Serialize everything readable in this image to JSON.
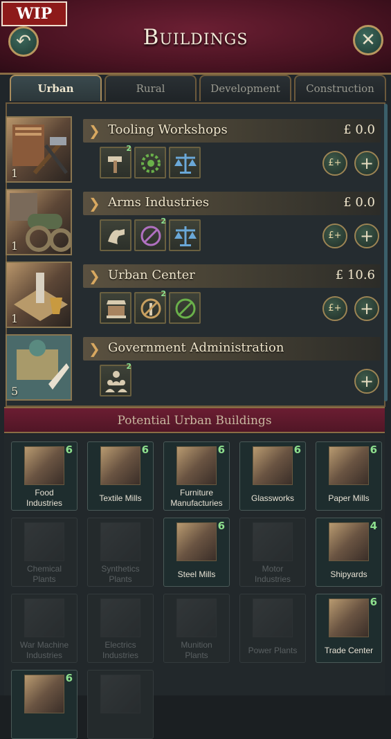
{
  "wip_label": "WIP",
  "header": {
    "title": "Buildings",
    "back_icon": "↶",
    "close_icon": "✕"
  },
  "tabs": [
    {
      "label": "Urban",
      "active": true
    },
    {
      "label": "Rural"
    },
    {
      "label": "Development"
    },
    {
      "label": "Construction"
    }
  ],
  "buildings": [
    {
      "name": "Tooling Workshops",
      "money": "£ 0.0",
      "level": "1",
      "methods": [
        {
          "icon": "hammer-icon",
          "count": "2"
        },
        {
          "icon": "gear-icon",
          "count": ""
        },
        {
          "icon": "scales-icon",
          "count": ""
        }
      ],
      "buttons": [
        "£+",
        "+"
      ]
    },
    {
      "name": "Arms Industries",
      "money": "£ 0.0",
      "level": "1",
      "methods": [
        {
          "icon": "cannon-icon",
          "count": ""
        },
        {
          "icon": "disabled-icon",
          "count": "2"
        },
        {
          "icon": "scales-icon",
          "count": ""
        }
      ],
      "buttons": [
        "£+",
        "+"
      ]
    },
    {
      "name": "Urban Center",
      "money": "£ 10.6",
      "level": "1",
      "methods": [
        {
          "icon": "market-stall-icon",
          "count": ""
        },
        {
          "icon": "lamp-icon",
          "count": "2"
        },
        {
          "icon": "disabled-icon",
          "count": ""
        }
      ],
      "buttons": [
        "£+",
        "+"
      ]
    },
    {
      "name": "Government Administration",
      "money": "",
      "level": "5",
      "methods": [
        {
          "icon": "bureaucrats-icon",
          "count": "2"
        }
      ],
      "buttons": [
        "+"
      ]
    }
  ],
  "section_title": "Potential Urban Buildings",
  "potential": [
    {
      "name": "Food\nIndustries",
      "num": "6",
      "dim": false
    },
    {
      "name": "Textile Mills",
      "num": "6",
      "dim": false
    },
    {
      "name": "Furniture\nManufacturies",
      "num": "6",
      "dim": false
    },
    {
      "name": "Glassworks",
      "num": "6",
      "dim": false
    },
    {
      "name": "Paper Mills",
      "num": "6",
      "dim": false
    },
    {
      "name": "Chemical\nPlants",
      "num": "",
      "dim": true
    },
    {
      "name": "Synthetics\nPlants",
      "num": "",
      "dim": true
    },
    {
      "name": "Steel Mills",
      "num": "6",
      "dim": false
    },
    {
      "name": "Motor\nIndustries",
      "num": "",
      "dim": true
    },
    {
      "name": "Shipyards",
      "num": "4",
      "dim": false
    },
    {
      "name": "War Machine\nIndustries",
      "num": "",
      "dim": true
    },
    {
      "name": "Electrics\nIndustries",
      "num": "",
      "dim": true
    },
    {
      "name": "Munition\nPlants",
      "num": "",
      "dim": true
    },
    {
      "name": "Power Plants",
      "num": "",
      "dim": true
    },
    {
      "name": "Trade Center",
      "num": "6",
      "dim": false
    },
    {
      "name": "",
      "num": "6",
      "dim": false
    },
    {
      "name": "",
      "num": "",
      "dim": true
    }
  ]
}
